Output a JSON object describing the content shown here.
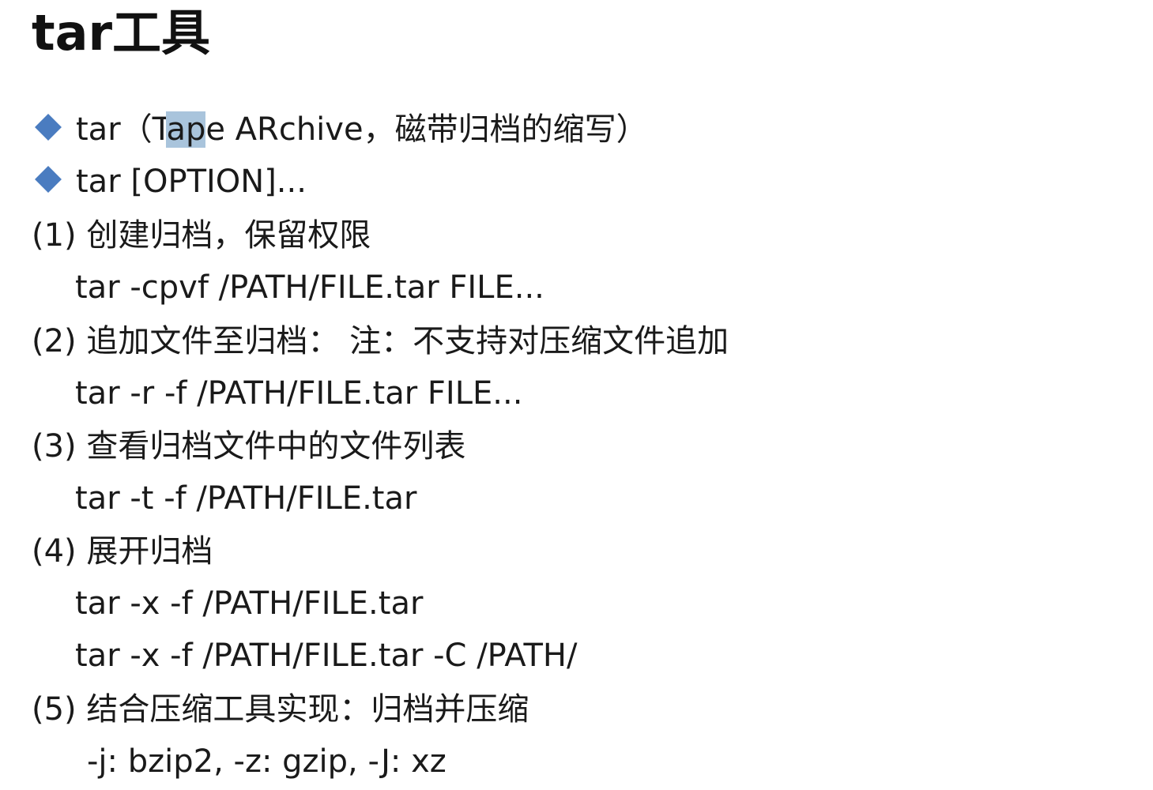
{
  "title": "tar工具",
  "bullets": [
    {
      "pre": "tar（T",
      "highlight": "ap",
      "post": "e ARchive，磁带归档的缩写）"
    },
    {
      "text": "tar [OPTION]..."
    }
  ],
  "items": [
    {
      "heading": "(1) 创建归档，保留权限",
      "commands": [
        "tar -cpvf /PATH/FILE.tar FILE..."
      ]
    },
    {
      "heading": "(2) 追加文件至归档： 注：不支持对压缩文件追加",
      "commands": [
        "tar -r -f /PATH/FILE.tar FILE..."
      ]
    },
    {
      "heading": "(3) 查看归档文件中的文件列表",
      "commands": [
        "tar -t -f /PATH/FILE.tar"
      ]
    },
    {
      "heading": "(4) 展开归档",
      "commands": [
        "tar -x -f /PATH/FILE.tar",
        "tar -x -f /PATH/FILE.tar -C /PATH/"
      ]
    },
    {
      "heading": "(5) 结合压缩工具实现：归档并压缩",
      "commands": [
        "-j: bzip2, -z: gzip, -J: xz"
      ]
    }
  ],
  "colors": {
    "bullet": "#4a7cc0",
    "highlight": "#a9c4dc",
    "text": "#1a1a1a"
  },
  "icons": {
    "bullet": "diamond-bullet-icon"
  }
}
